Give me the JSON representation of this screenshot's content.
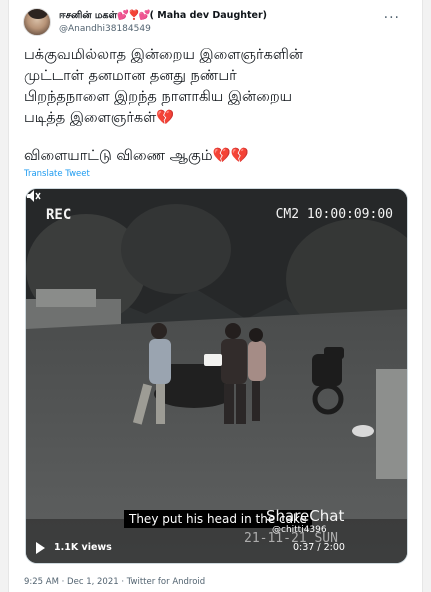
{
  "user": {
    "display_name": "ஈசனின் மகள்",
    "display_suffix": "( Maha dev Daughter)",
    "hearts": "💕❣️💕",
    "handle": "@Anandhi38184549"
  },
  "tweet": {
    "lines": [
      "பக்குவமில்லாத இன்றைய இளைஞர்களின்",
      "முட்டாள் தனமான தனது நண்பர்",
      "பிறந்தநாளை இறந்த நாளாகிய இன்றைய",
      "படித்த இளைஞர்கள்"
    ],
    "line4_emoji": "💔",
    "line5": "விளையாட்டு விணை ஆகும்",
    "line5_emoji": "💔💔",
    "translate_label": "Translate Tweet"
  },
  "video": {
    "rec_label": "REC",
    "camera_label": "CM2 10:00:09:00",
    "subtitle": "They put his head in the cake",
    "watermark": "ShareChat",
    "watermark_handle": "@chitti4396",
    "overlay_date": "21-11-21 SUN",
    "views": "1.1K views",
    "time": "0:37 / 2:00"
  },
  "footer": {
    "timestamp": "9:25 AM · Dec 1, 2021 · Twitter for Android"
  },
  "colors": {
    "accent": "#1d9bf0",
    "heart": "#e0245e"
  },
  "icons": [
    "more-icon",
    "play-icon",
    "volume-icon",
    "broken-heart-icon"
  ]
}
